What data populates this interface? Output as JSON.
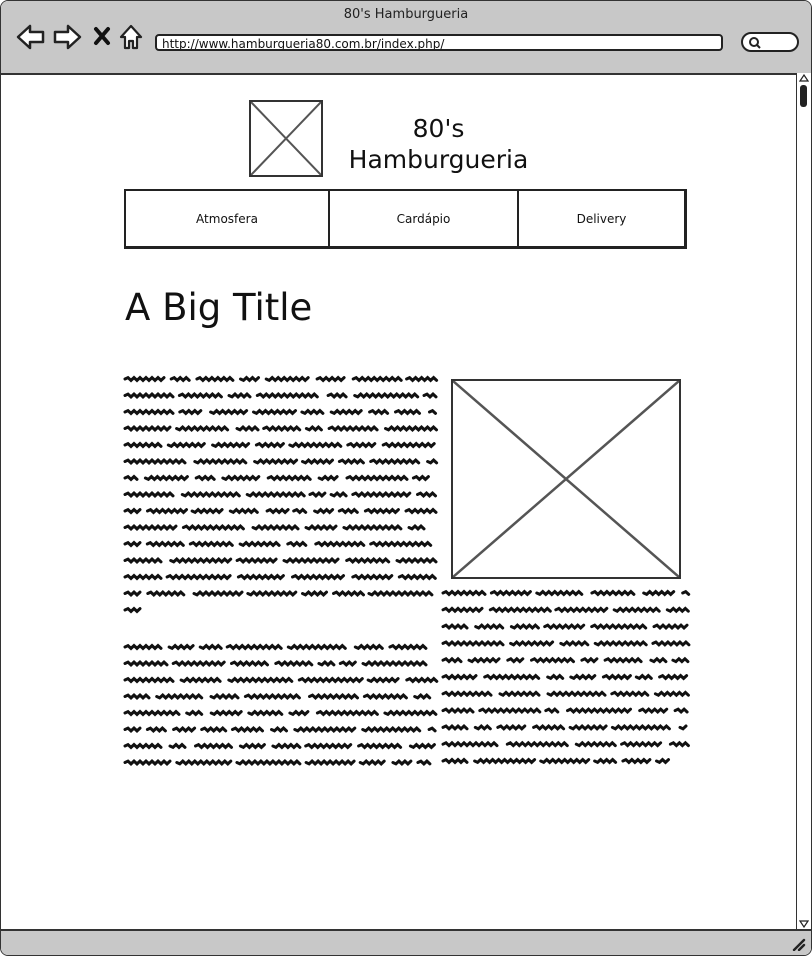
{
  "browser": {
    "window_title": "80's Hamburgueria",
    "url": "http://www.hamburgueria80.com.br/index.php/",
    "icons": [
      "back-arrow-icon",
      "forward-arrow-icon",
      "close-x-icon",
      "home-icon",
      "search-icon"
    ]
  },
  "header": {
    "logo_icon": "image-placeholder-icon",
    "brand_line1": "80's",
    "brand_line2": "Hamburgueria"
  },
  "nav": {
    "items": [
      {
        "label": "Atmosfera"
      },
      {
        "label": "Cardápio"
      },
      {
        "label": "Delivery"
      }
    ]
  },
  "main": {
    "title": "A Big Title",
    "image_icon": "image-placeholder-icon"
  },
  "colors": {
    "chrome": "#c8c8c8",
    "stroke": "#333333",
    "scribble": "#111111"
  }
}
